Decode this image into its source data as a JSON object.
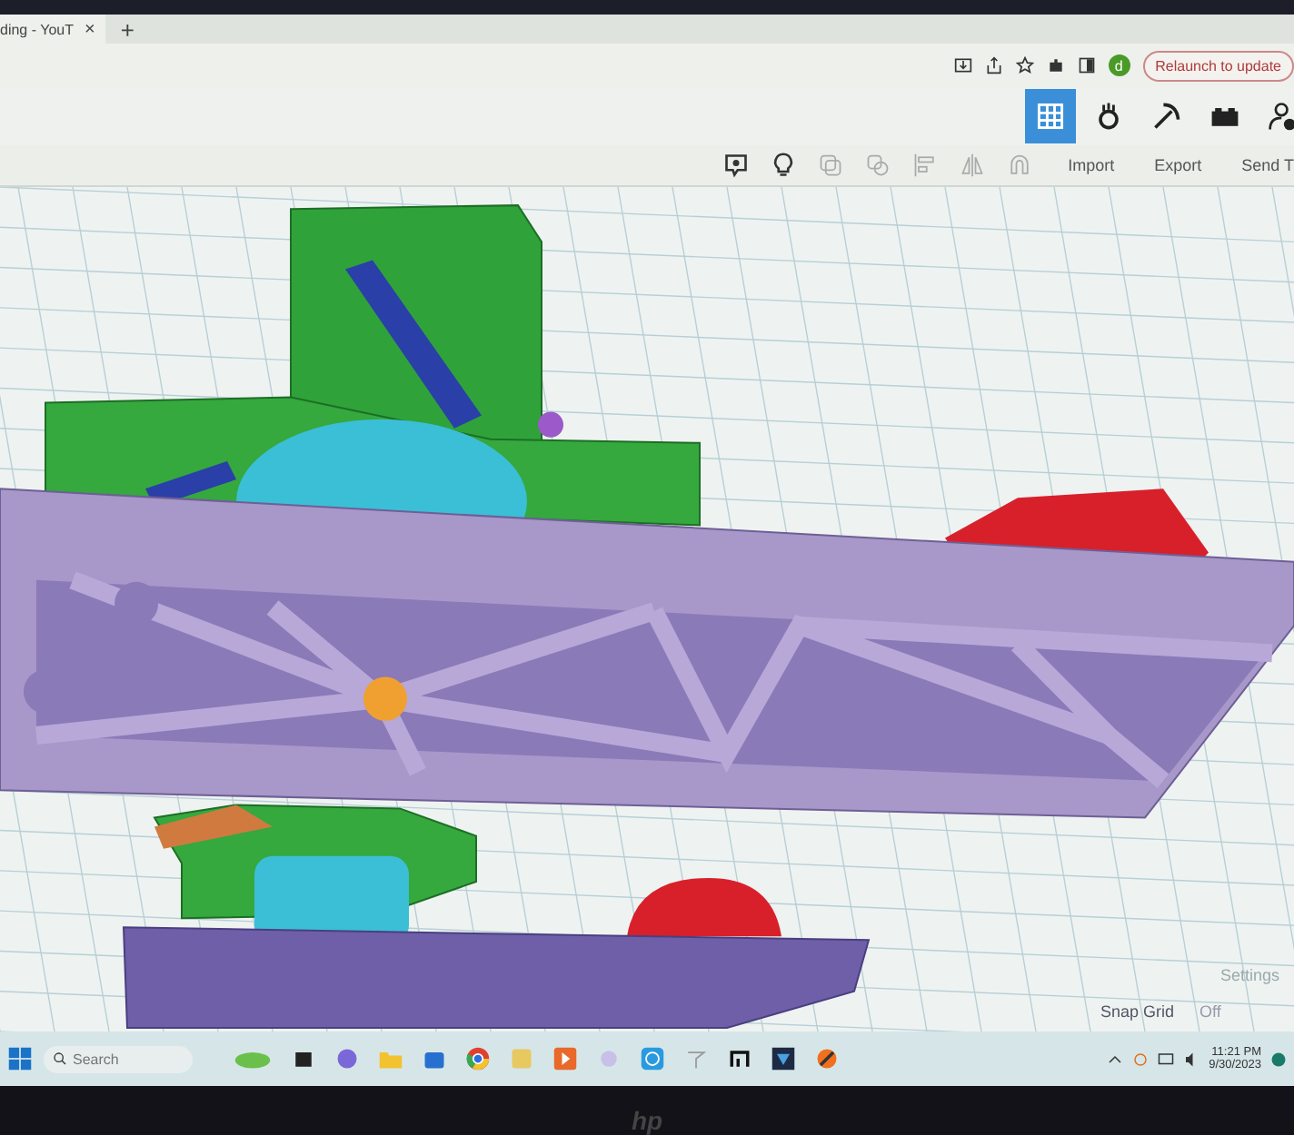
{
  "browser": {
    "tab": {
      "title": "ding - YouT",
      "close": "×"
    },
    "new_tab": "+",
    "profile_initial": "d",
    "relaunch_button": "Relaunch to update"
  },
  "view_buttons": [
    {
      "kind": "grid",
      "selected": true
    },
    {
      "kind": "bulb",
      "selected": false
    },
    {
      "kind": "pickaxe",
      "selected": false
    },
    {
      "kind": "brick",
      "selected": false
    },
    {
      "kind": "user",
      "selected": false
    }
  ],
  "app_toolbar": {
    "buttons": [
      "Import",
      "Export",
      "Send T"
    ]
  },
  "canvas": {
    "settings": "Settings",
    "snap_grid": {
      "label": "Snap Grid",
      "value": "Off"
    }
  },
  "taskbar": {
    "search_placeholder": "Search",
    "time": "11:21 PM",
    "date": "9/30/2023"
  },
  "bezel": {
    "logo": "hp"
  }
}
